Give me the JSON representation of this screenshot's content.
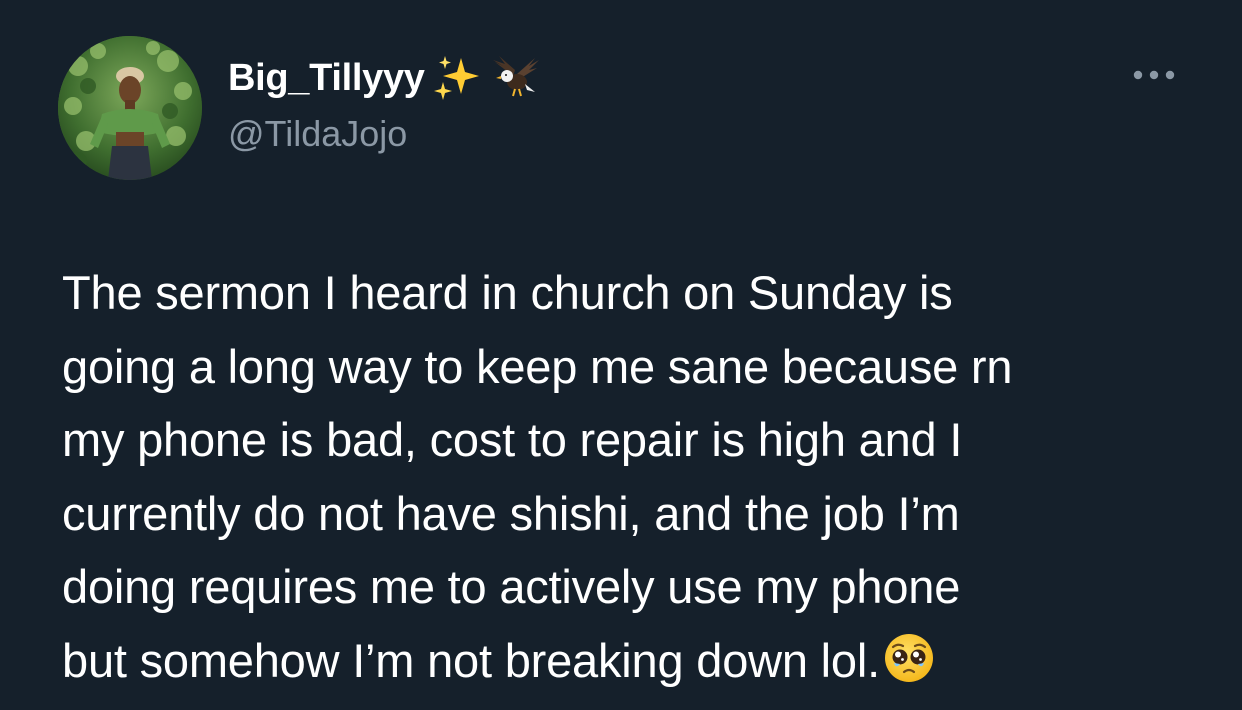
{
  "tweet": {
    "author": {
      "display_name": "Big_Tillyyy",
      "handle": "@TildaJojo",
      "name_emojis": [
        "sparkles-icon",
        "eagle-icon"
      ]
    },
    "more_icon": "ellipsis-icon",
    "text_lines": [
      "The sermon I heard in church on Sunday is",
      "going a long way to keep me sane because rn",
      "my phone is bad, cost to repair is high and I",
      "currently do not have shishi, and the job I’m",
      "doing requires me to actively use my phone",
      "but somehow I’m not breaking down lol."
    ],
    "trailing_emoji": "pleading-face-icon"
  },
  "colors": {
    "background": "#15202b",
    "text_primary": "#ffffff",
    "text_secondary": "#8b98a5"
  }
}
